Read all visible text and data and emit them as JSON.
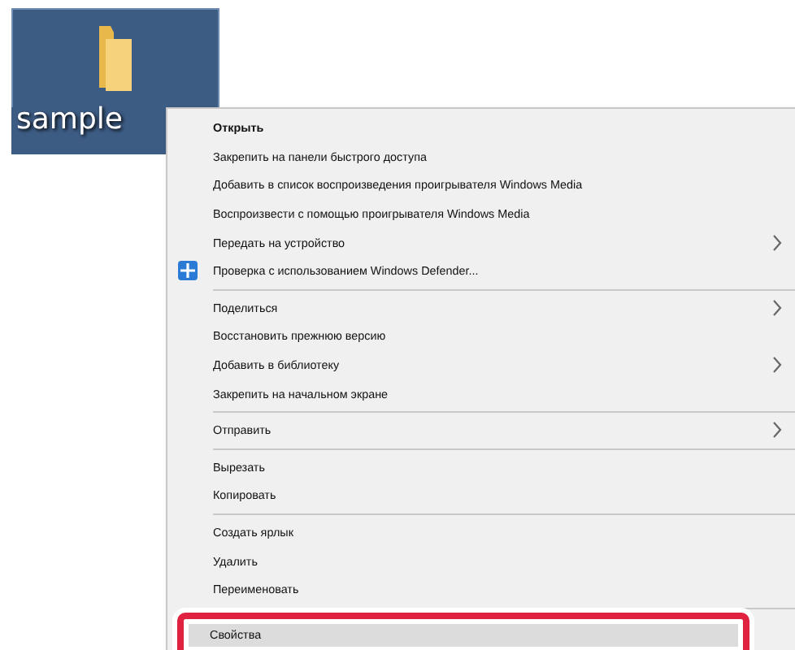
{
  "desktop_icon": {
    "label": "sample",
    "selected": true
  },
  "context_menu": {
    "groups": [
      [
        {
          "label": "Открыть",
          "bold": true,
          "submenu": false,
          "icon": false,
          "selected": false,
          "highlighted": false
        },
        {
          "label": "Закрепить на панели быстрого доступа",
          "bold": false,
          "submenu": false,
          "icon": false,
          "selected": false,
          "highlighted": false
        },
        {
          "label": "Добавить в список воспроизведения проигрывателя Windows Media",
          "bold": false,
          "submenu": false,
          "icon": false,
          "selected": false,
          "highlighted": false
        },
        {
          "label": "Воспроизвести с помощью проигрывателя Windows Media",
          "bold": false,
          "submenu": false,
          "icon": false,
          "selected": false,
          "highlighted": false
        },
        {
          "label": "Передать на устройство",
          "bold": false,
          "submenu": true,
          "icon": false,
          "selected": false,
          "highlighted": false
        },
        {
          "label": "Проверка с использованием Windows Defender...",
          "bold": false,
          "submenu": false,
          "icon": true,
          "selected": false,
          "highlighted": false
        }
      ],
      [
        {
          "label": "Поделиться",
          "bold": false,
          "submenu": true,
          "icon": false,
          "selected": false,
          "highlighted": false
        },
        {
          "label": "Восстановить прежнюю версию",
          "bold": false,
          "submenu": false,
          "icon": false,
          "selected": false,
          "highlighted": false
        },
        {
          "label": "Добавить в библиотеку",
          "bold": false,
          "submenu": true,
          "icon": false,
          "selected": false,
          "highlighted": false
        },
        {
          "label": "Закрепить на начальном экране",
          "bold": false,
          "submenu": false,
          "icon": false,
          "selected": false,
          "highlighted": false
        }
      ],
      [
        {
          "label": "Отправить",
          "bold": false,
          "submenu": true,
          "icon": false,
          "selected": false,
          "highlighted": false
        }
      ],
      [
        {
          "label": "Вырезать",
          "bold": false,
          "submenu": false,
          "icon": false,
          "selected": false,
          "highlighted": false
        },
        {
          "label": "Копировать",
          "bold": false,
          "submenu": false,
          "icon": false,
          "selected": false,
          "highlighted": false
        }
      ],
      [
        {
          "label": "Создать ярлык",
          "bold": false,
          "submenu": false,
          "icon": false,
          "selected": false,
          "highlighted": false
        },
        {
          "label": "Удалить",
          "bold": false,
          "submenu": false,
          "icon": false,
          "selected": false,
          "highlighted": false
        },
        {
          "label": "Переименовать",
          "bold": false,
          "submenu": false,
          "icon": false,
          "selected": false,
          "highlighted": false
        }
      ],
      [
        {
          "label": "Свойства",
          "bold": false,
          "submenu": false,
          "icon": false,
          "selected": true,
          "highlighted": true
        }
      ]
    ]
  }
}
